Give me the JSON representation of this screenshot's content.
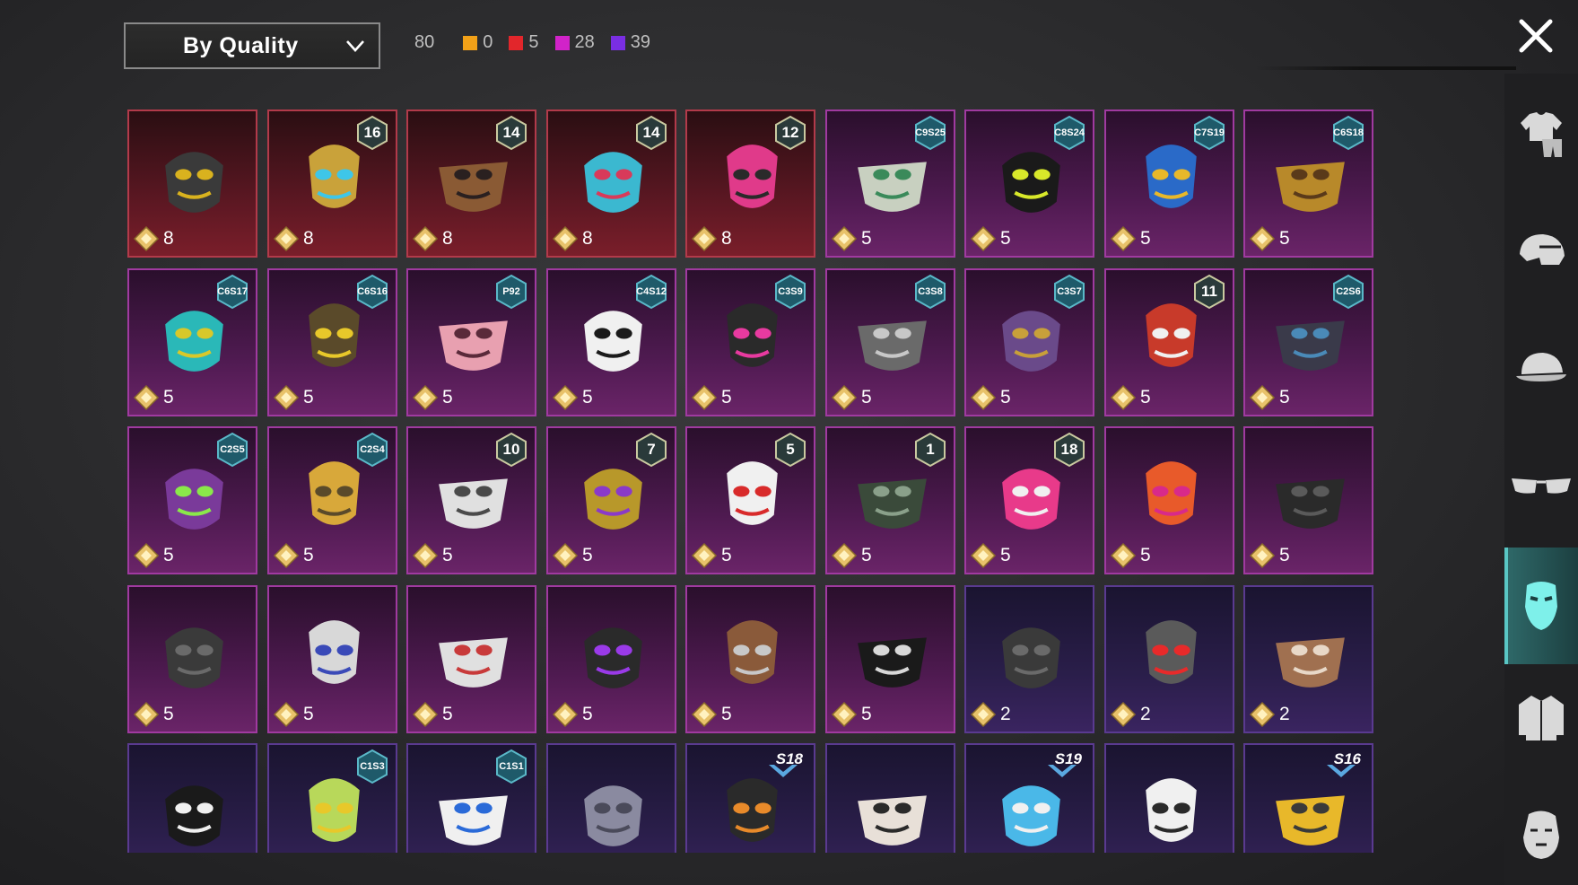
{
  "filter": {
    "sort_label": "By Quality"
  },
  "counts": {
    "total": "80",
    "items": [
      {
        "value": "0",
        "color": "#f2a118"
      },
      {
        "value": "5",
        "color": "#e2262b"
      },
      {
        "value": "28",
        "color": "#d123c9"
      },
      {
        "value": "39",
        "color": "#7a2ee2"
      }
    ]
  },
  "sidebar": {
    "categories": [
      {
        "name": "outfit-icon"
      },
      {
        "name": "helmet-icon"
      },
      {
        "name": "cap-icon"
      },
      {
        "name": "glasses-icon"
      },
      {
        "name": "mask-icon",
        "active": true
      },
      {
        "name": "jacket-icon"
      },
      {
        "name": "face-icon"
      }
    ]
  },
  "items": [
    {
      "quality": "red",
      "price": "8",
      "badge": "",
      "icon": "cyber-helmet-mask",
      "art": "#3a3a3a",
      "accent": "#d9b21e"
    },
    {
      "quality": "red",
      "price": "8",
      "badge": "16",
      "icon": "gold-blue-mask",
      "art": "#c9a23a",
      "accent": "#3ec6e8"
    },
    {
      "quality": "red",
      "price": "8",
      "badge": "14",
      "icon": "bronze-mouth-guard",
      "art": "#8a5a34",
      "accent": "#2a2020"
    },
    {
      "quality": "red",
      "price": "8",
      "badge": "14",
      "icon": "cyan-robot-helmet",
      "art": "#3bb8d0",
      "accent": "#d83a5a"
    },
    {
      "quality": "red",
      "price": "8",
      "badge": "12",
      "icon": "pink-headset-mask",
      "art": "#e03a8a",
      "accent": "#2a2a2a"
    },
    {
      "quality": "pink",
      "price": "5",
      "badge": "C9S25",
      "icon": "green-wing-mask",
      "art": "#c8d0c0",
      "accent": "#3a8a5a"
    },
    {
      "quality": "pink",
      "price": "5",
      "badge": "C8S24",
      "icon": "neon-visor",
      "art": "#1a1a1a",
      "accent": "#d8e82a"
    },
    {
      "quality": "pink",
      "price": "5",
      "badge": "C7S19",
      "icon": "blue-gold-mask",
      "art": "#2a6ac8",
      "accent": "#e8b82a"
    },
    {
      "quality": "pink",
      "price": "5",
      "badge": "C6S18",
      "icon": "gold-horn-mask",
      "art": "#b8892a",
      "accent": "#5a3a1a"
    },
    {
      "quality": "pink",
      "price": "5",
      "badge": "C6S17",
      "icon": "teal-paint-mask",
      "art": "#2ab8b8",
      "accent": "#d8c82a"
    },
    {
      "quality": "pink",
      "price": "5",
      "badge": "C6S16",
      "icon": "yellow-gas-mask",
      "art": "#5a4a2a",
      "accent": "#e8c82a"
    },
    {
      "quality": "pink",
      "price": "5",
      "badge": "P92",
      "icon": "pink-skull-mask",
      "art": "#e8a0b0",
      "accent": "#5a2a3a"
    },
    {
      "quality": "pink",
      "price": "5",
      "badge": "C4S12",
      "icon": "white-fang-mask",
      "art": "#f0f0f0",
      "accent": "#1a1a1a"
    },
    {
      "quality": "pink",
      "price": "5",
      "badge": "C3S9",
      "icon": "black-pink-respirator",
      "art": "#2a2a2a",
      "accent": "#e83aa0"
    },
    {
      "quality": "pink",
      "price": "5",
      "badge": "C3S8",
      "icon": "gray-respirator",
      "art": "#6a6a6a",
      "accent": "#c8c8c8"
    },
    {
      "quality": "pink",
      "price": "5",
      "badge": "C3S7",
      "icon": "purple-gold-veil",
      "art": "#6a4a8a",
      "accent": "#c8a03a"
    },
    {
      "quality": "pink",
      "price": "5",
      "badge": "11",
      "icon": "red-oni-mask",
      "art": "#c83a2a",
      "accent": "#f0f0f0"
    },
    {
      "quality": "pink",
      "price": "5",
      "badge": "C2S6",
      "icon": "dark-cloth-mask",
      "art": "#3a3a4a",
      "accent": "#4a8ab8"
    },
    {
      "quality": "pink",
      "price": "5",
      "badge": "C2S5",
      "icon": "purple-lime-mask",
      "art": "#7a3a9a",
      "accent": "#8ae84a"
    },
    {
      "quality": "pink",
      "price": "5",
      "badge": "C2S4",
      "icon": "gold-tactical-mask",
      "art": "#d8a83a",
      "accent": "#5a4a2a"
    },
    {
      "quality": "pink",
      "price": "5",
      "badge": "10",
      "icon": "white-gas-mask",
      "art": "#e0e0e0",
      "accent": "#4a4a4a"
    },
    {
      "quality": "pink",
      "price": "5",
      "badge": "7",
      "icon": "gold-purple-mask",
      "art": "#b8982a",
      "accent": "#8a3ac8"
    },
    {
      "quality": "pink",
      "price": "5",
      "badge": "5",
      "icon": "clown-mask",
      "art": "#f0f0f0",
      "accent": "#d82a2a"
    },
    {
      "quality": "pink",
      "price": "5",
      "badge": "1",
      "icon": "dark-knight-helmet",
      "art": "#3a4a3a",
      "accent": "#8aa08a"
    },
    {
      "quality": "pink",
      "price": "5",
      "badge": "18",
      "icon": "pink-cloth-mask",
      "art": "#e83a8a",
      "accent": "#f0f0f0"
    },
    {
      "quality": "pink",
      "price": "5",
      "badge": "",
      "icon": "orange-pink-respirator",
      "art": "#e85a2a",
      "accent": "#d82a8a"
    },
    {
      "quality": "pink",
      "price": "5",
      "badge": "",
      "icon": "black-panther-mask",
      "art": "#2a2a2a",
      "accent": "#5a5a5a"
    },
    {
      "quality": "pink",
      "price": "5",
      "badge": "",
      "icon": "black-gas-mask",
      "art": "#3a3a3a",
      "accent": "#6a6a6a"
    },
    {
      "quality": "pink",
      "price": "5",
      "badge": "",
      "icon": "breathing-tube",
      "art": "#d8d8d8",
      "accent": "#3a4ab8"
    },
    {
      "quality": "pink",
      "price": "5",
      "badge": "",
      "icon": "skull-bandana",
      "art": "#e0e0e0",
      "accent": "#c83a3a"
    },
    {
      "quality": "pink",
      "price": "5",
      "badge": "",
      "icon": "purple-goggle-mask",
      "art": "#2a2a2a",
      "accent": "#9a3ae8"
    },
    {
      "quality": "pink",
      "price": "5",
      "badge": "",
      "icon": "plague-doctor-mask",
      "art": "#8a5a3a",
      "accent": "#c8c8c8"
    },
    {
      "quality": "pink",
      "price": "5",
      "badge": "",
      "icon": "skull-face-wrap",
      "art": "#1a1a1a",
      "accent": "#d8d8d8"
    },
    {
      "quality": "purple",
      "price": "2",
      "badge": "",
      "icon": "black-half-mask",
      "art": "#3a3a3a",
      "accent": "#6a6a6a"
    },
    {
      "quality": "purple",
      "price": "2",
      "badge": "",
      "icon": "red-laser-visor",
      "art": "#5a5a5a",
      "accent": "#e82a2a"
    },
    {
      "quality": "purple",
      "price": "2",
      "badge": "",
      "icon": "hairy-beast-mask",
      "art": "#a07050",
      "accent": "#e8d8c8"
    },
    {
      "quality": "purple",
      "price": "",
      "badge": "",
      "icon": "black-smile-mask",
      "art": "#1a1a1a",
      "accent": "#f0f0f0"
    },
    {
      "quality": "purple",
      "price": "",
      "badge": "C1S3",
      "icon": "green-cactus-mask",
      "art": "#b8d85a",
      "accent": "#e8c82a"
    },
    {
      "quality": "purple",
      "price": "",
      "badge": "C1S1",
      "icon": "blue-white-mask",
      "art": "#f0f0f0",
      "accent": "#2a6ad8"
    },
    {
      "quality": "purple",
      "price": "",
      "badge": "",
      "icon": "steel-face-mask",
      "art": "#8a8aa0",
      "accent": "#4a4a5a"
    },
    {
      "quality": "purple",
      "price": "",
      "badge": "S18",
      "icon": "heartbeat-mask",
      "art": "#2a2a2a",
      "accent": "#e88a2a"
    },
    {
      "quality": "purple",
      "price": "",
      "badge": "",
      "icon": "skeleton-mask",
      "art": "#e8e0d8",
      "accent": "#2a2a2a"
    },
    {
      "quality": "purple",
      "price": "",
      "badge": "S19",
      "icon": "blue-wing-visor",
      "art": "#4ab8e8",
      "accent": "#f0f0f0"
    },
    {
      "quality": "purple",
      "price": "",
      "badge": "",
      "icon": "white-hockey-mask",
      "art": "#f0f0f0",
      "accent": "#2a2a2a"
    },
    {
      "quality": "purple",
      "price": "",
      "badge": "S16",
      "icon": "yellow-tactical-helmet",
      "art": "#e8b82a",
      "accent": "#3a3a3a"
    }
  ]
}
